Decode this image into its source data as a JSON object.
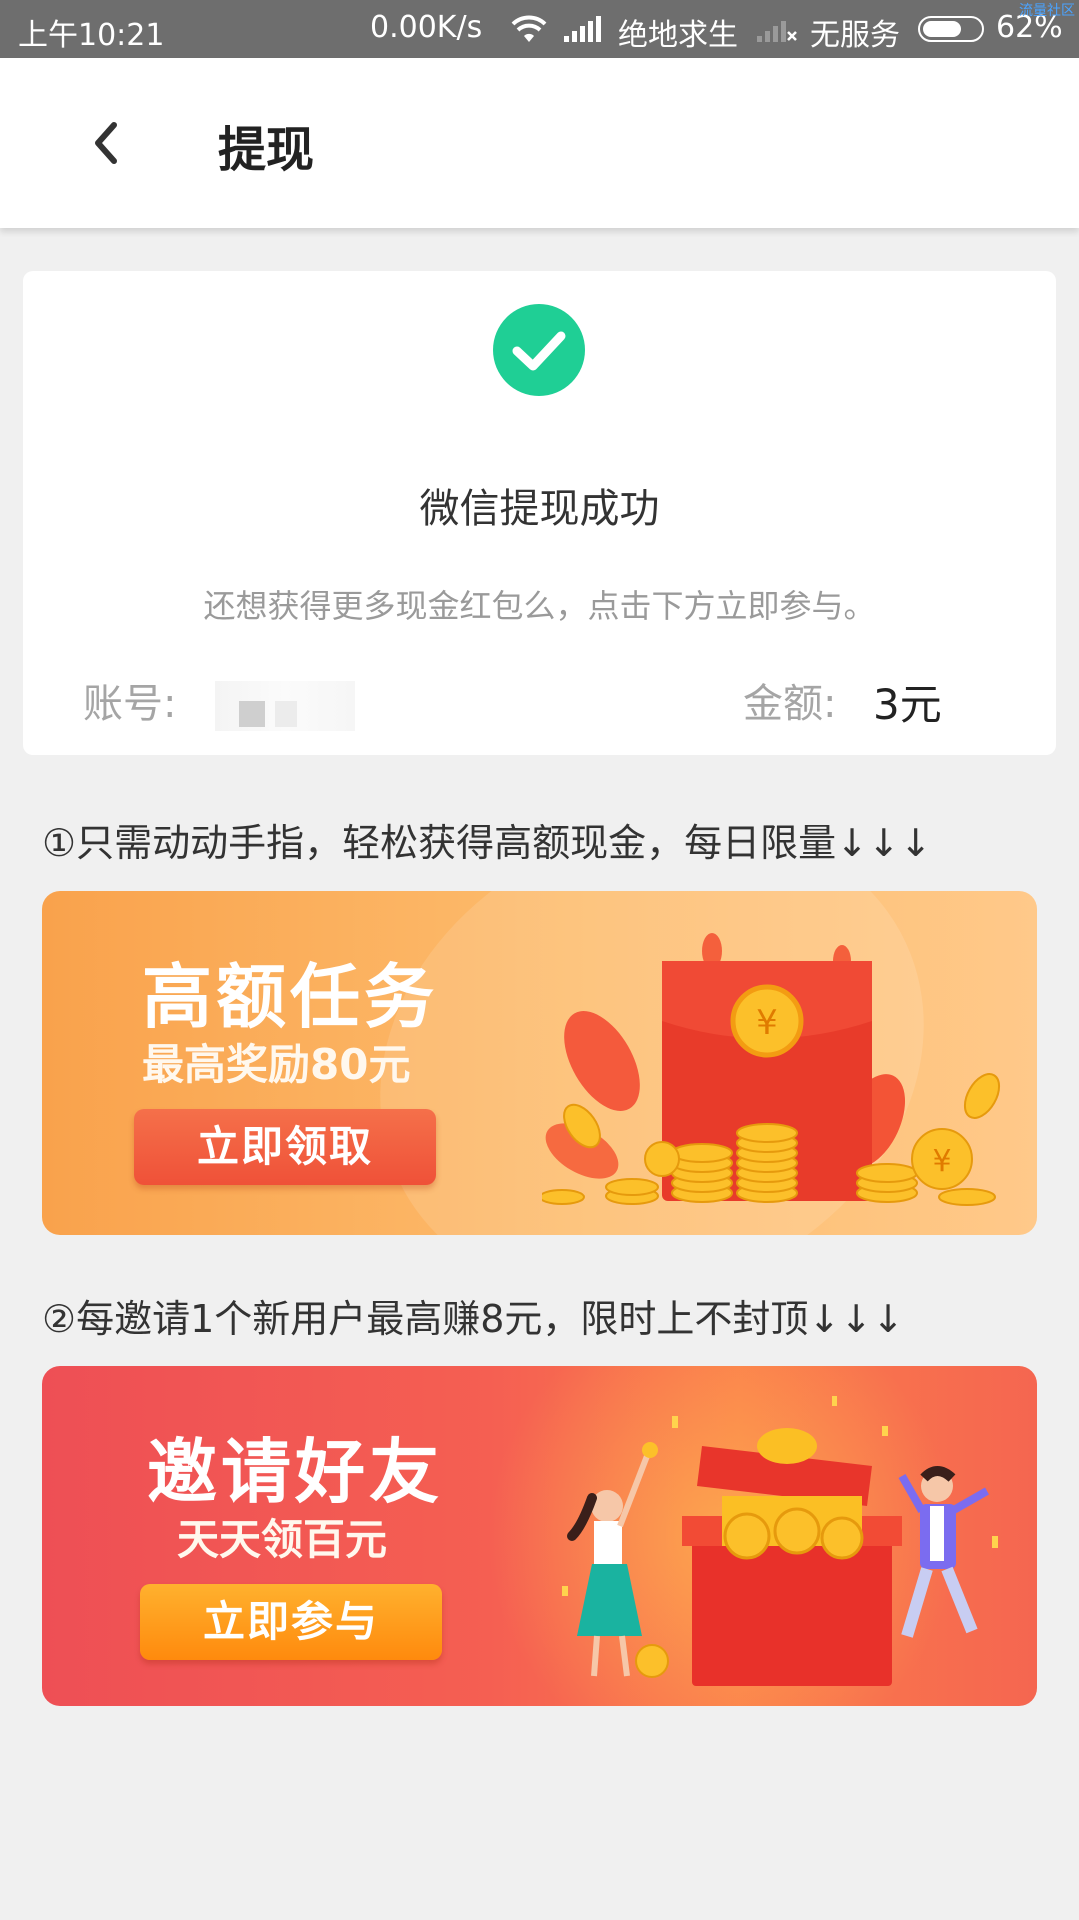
{
  "status_bar": {
    "time": "上午10:21",
    "speed": "0.00K/s",
    "carrier1": "绝地求生",
    "carrier2": "无服务",
    "battery": "62%",
    "corner_mark": "流量社区"
  },
  "header": {
    "title": "提现"
  },
  "result_card": {
    "status_text": "微信提现成功",
    "hint_text": "还想获得更多现金红包么，点击下方立即参与。",
    "account_label": "账号:",
    "amount_label": "金额:",
    "amount_value": "3元",
    "accent_color": "#1fcf95"
  },
  "promos": [
    {
      "caption": "①只需动动手指，轻松获得高额现金，每日限量↓↓↓",
      "title": "高额任务",
      "subtitle": "最高奖励80元",
      "button": "立即领取"
    },
    {
      "caption": "②每邀请1个新用户最高赚8元，限时上不封顶↓↓↓",
      "title": "邀请好友",
      "subtitle": "天天领百元",
      "button": "立即参与"
    }
  ]
}
